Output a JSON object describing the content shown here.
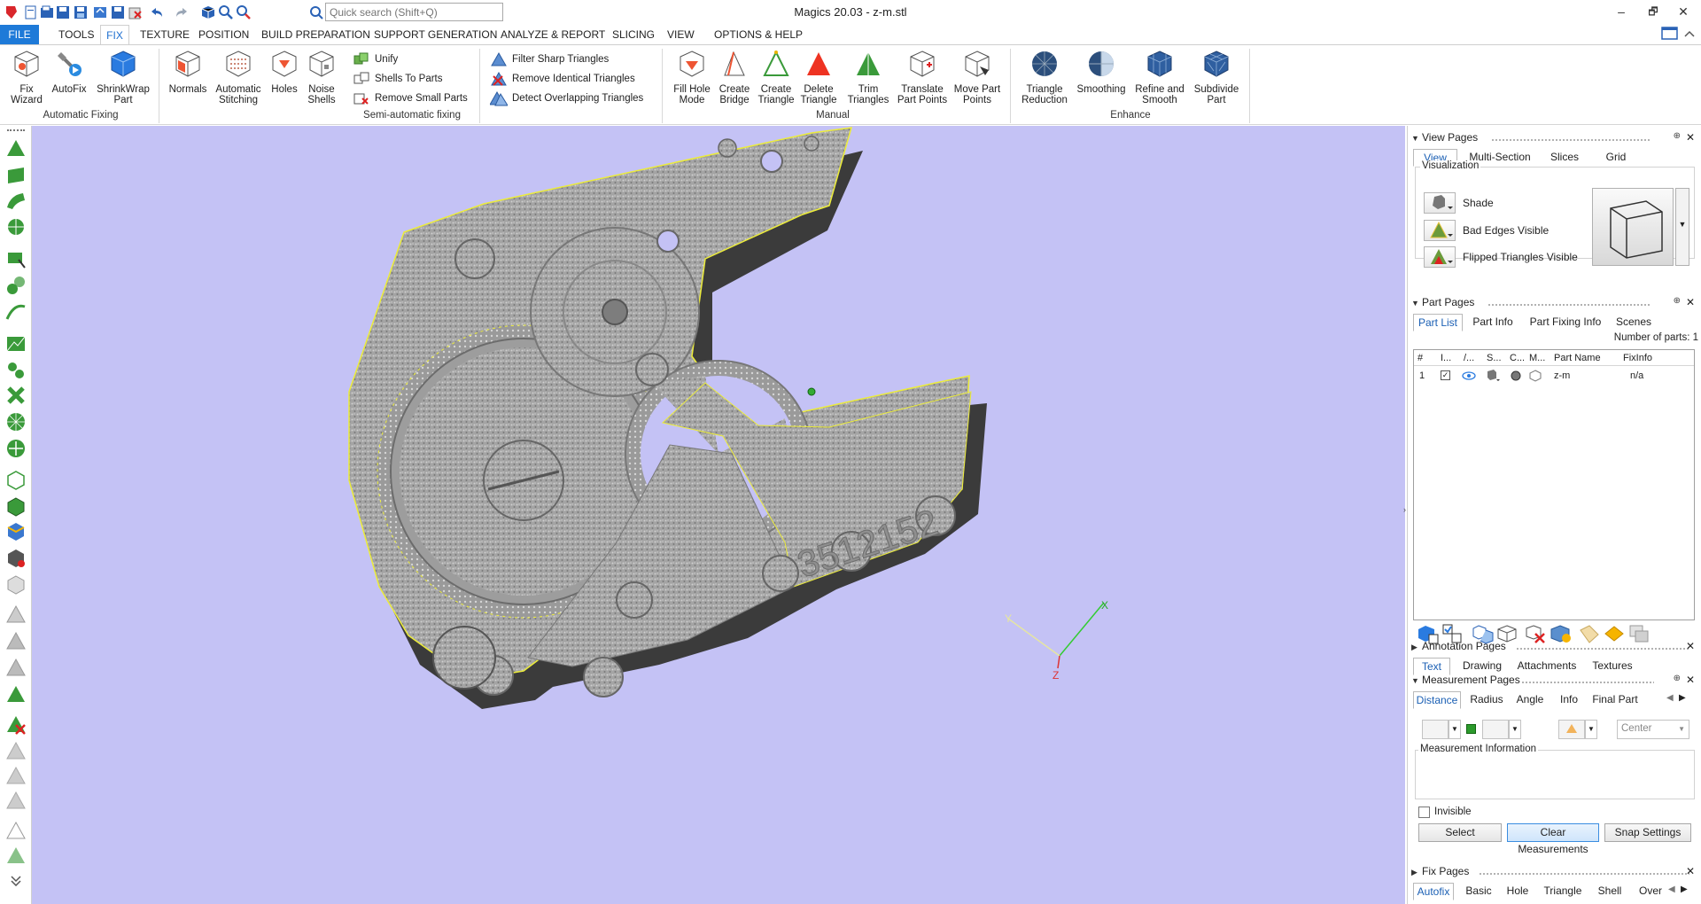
{
  "window": {
    "title": "Magics 20.03 - z-m.stl",
    "search_placeholder": "Quick search (Shift+Q)",
    "controls": {
      "minimize": "–",
      "restore": "🗗",
      "close": "✕"
    }
  },
  "menu": {
    "items": [
      "FILE",
      "TOOLS",
      "FIX",
      "TEXTURE",
      "POSITION",
      "BUILD PREPARATION",
      "SUPPORT GENERATION",
      "ANALYZE & REPORT",
      "SLICING",
      "VIEW",
      "OPTIONS & HELP"
    ],
    "active": "FIX"
  },
  "ribbon": {
    "automatic_fixing": {
      "label": "Automatic Fixing",
      "fix_wizard": "Fix\nWizard",
      "autofix": "AutoFix",
      "shrinkwrap": "ShrinkWrap\nPart"
    },
    "semi_automatic": {
      "label": "Semi-automatic fixing",
      "normals": "Normals",
      "auto_stitching": "Automatic\nStitching",
      "holes": "Holes",
      "noise_shells": "Noise\nShells",
      "unify": "Unify",
      "shells_to_parts": "Shells To Parts",
      "remove_small_parts": "Remove Small Parts",
      "filter_sharp": "Filter Sharp Triangles",
      "remove_identical": "Remove Identical Triangles",
      "detect_overlapping": "Detect Overlapping Triangles"
    },
    "manual": {
      "label": "Manual",
      "fill_hole_mode": "Fill Hole\nMode",
      "create_bridge": "Create\nBridge",
      "create_triangle": "Create\nTriangle",
      "delete_triangle": "Delete\nTriangle",
      "trim_triangles": "Trim\nTriangles",
      "translate_part_points": "Translate\nPart Points",
      "move_part_points": "Move Part\nPoints"
    },
    "enhance": {
      "label": "Enhance",
      "triangle_reduction": "Triangle\nReduction",
      "smoothing": "Smoothing",
      "refine_and_smooth": "Refine and\nSmooth",
      "subdivide_part": "Subdivide\nPart"
    }
  },
  "viewport": {
    "background": "#c4c2f5",
    "axis_labels": {
      "x": "X",
      "y": "Y",
      "z": "Z"
    },
    "model_text": "3512152"
  },
  "panels": {
    "view_pages": {
      "title": "View Pages",
      "tabs": [
        "View",
        "Multi-Section",
        "Slices",
        "Grid"
      ],
      "section": "Visualization",
      "rows": [
        "Shade",
        "Bad Edges Visible",
        "Flipped Triangles Visible"
      ]
    },
    "part_pages": {
      "title": "Part Pages",
      "tabs": [
        "Part List",
        "Part Info",
        "Part Fixing Info",
        "Scenes"
      ],
      "num_parts_label": "Number of parts: 1",
      "columns": [
        "#",
        "I...",
        "/...",
        "S...",
        "C...",
        "M...",
        "Part Name",
        "FixInfo"
      ],
      "rows": [
        {
          "num": "1",
          "name": "z-m",
          "fixinfo": "n/a"
        }
      ]
    },
    "annotation_pages": {
      "title": "Annotation Pages",
      "tabs": [
        "Text",
        "Drawing",
        "Attachments",
        "Textures"
      ]
    },
    "measurement_pages": {
      "title": "Measurement Pages",
      "tabs": [
        "Distance",
        "Radius",
        "Angle",
        "Info",
        "Final Part"
      ],
      "center_select": "Center",
      "info_label": "Measurement Information",
      "invisible_label": "Invisible",
      "buttons": [
        "Select",
        "Clear Measurements",
        "Snap Settings"
      ]
    },
    "fix_pages": {
      "title": "Fix Pages",
      "tabs": [
        "Autofix",
        "Basic",
        "Hole",
        "Triangle",
        "Shell",
        "Over"
      ]
    }
  },
  "colors": {
    "accent": "#1e7ad8",
    "selection_yellow": "#ecec3a"
  }
}
